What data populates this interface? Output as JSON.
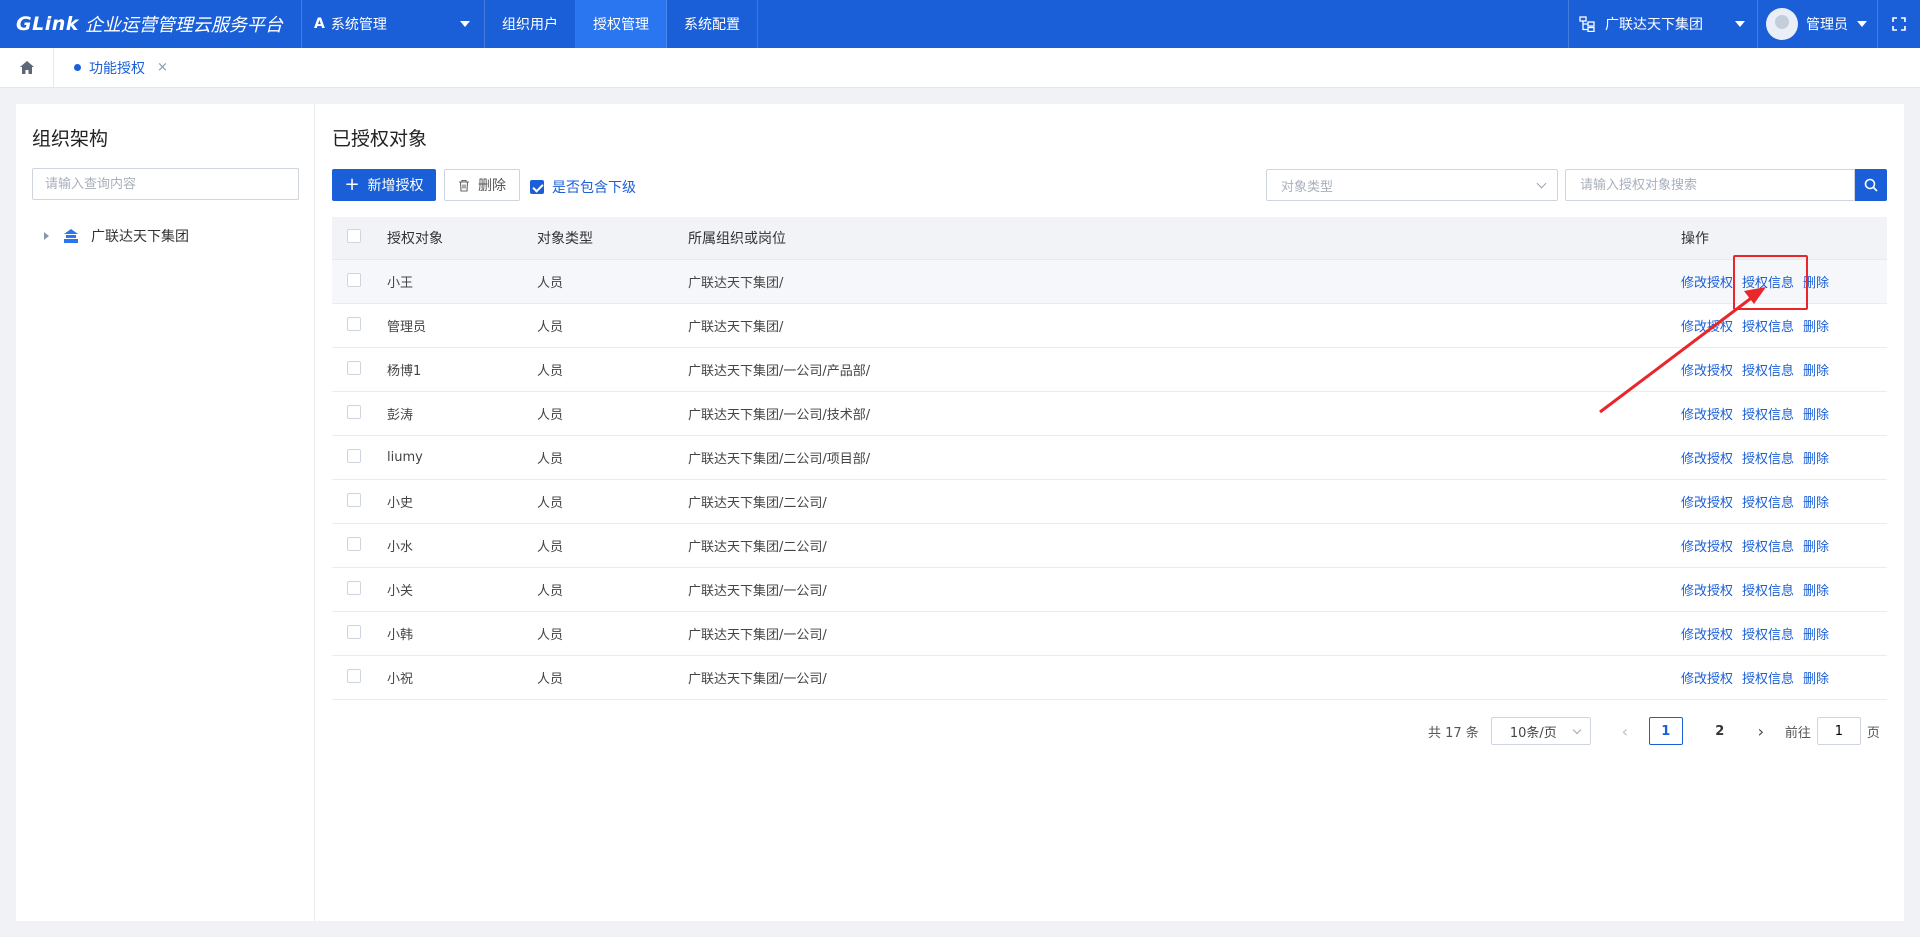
{
  "header": {
    "logo": "GLink",
    "platform_name": "企业运营管理云服务平台",
    "system_menu": "系统管理",
    "nav_tabs": [
      {
        "label": "组织用户"
      },
      {
        "label": "授权管理"
      },
      {
        "label": "系统配置"
      }
    ],
    "active_tab": "授权管理",
    "org_name": "广联达天下集团",
    "user_name": "管理员",
    "brand_color": "#1a5fd8"
  },
  "breadcrumb": {
    "tab_label": "功能授权",
    "close_label": "×"
  },
  "left_panel": {
    "title": "组织架构",
    "search_placeholder": "请输入查询内容",
    "tree": [
      {
        "label": "广联达天下集团"
      }
    ]
  },
  "main": {
    "title": "已授权对象",
    "add_button": "新增授权",
    "delete_button": "删除",
    "include_sub_label": "是否包含下级",
    "include_sub_checked": true,
    "type_select_placeholder": "对象类型",
    "search_placeholder": "请输入授权对象搜索",
    "table": {
      "headers": {
        "object": "授权对象",
        "type": "对象类型",
        "org": "所属组织或岗位",
        "ops": "操作"
      },
      "action_labels": {
        "modify": "修改授权",
        "info": "授权信息",
        "delete": "删除"
      },
      "rows": [
        {
          "object": "小王",
          "type": "人员",
          "org": "广联达天下集团/"
        },
        {
          "object": "管理员",
          "type": "人员",
          "org": "广联达天下集团/"
        },
        {
          "object": "杨博1",
          "type": "人员",
          "org": "广联达天下集团/一公司/产品部/"
        },
        {
          "object": "彭涛",
          "type": "人员",
          "org": "广联达天下集团/一公司/技术部/"
        },
        {
          "object": "liumy",
          "type": "人员",
          "org": "广联达天下集团/二公司/项目部/"
        },
        {
          "object": "小史",
          "type": "人员",
          "org": "广联达天下集团/二公司/"
        },
        {
          "object": "小水",
          "type": "人员",
          "org": "广联达天下集团/二公司/"
        },
        {
          "object": "小关",
          "type": "人员",
          "org": "广联达天下集团/一公司/"
        },
        {
          "object": "小韩",
          "type": "人员",
          "org": "广联达天下集团/一公司/"
        },
        {
          "object": "小祝",
          "type": "人员",
          "org": "广联达天下集团/一公司/"
        }
      ]
    },
    "pagination": {
      "total": "共 17 条",
      "page_size": "10条/页",
      "pages": [
        "1",
        "2"
      ],
      "current_page": "1",
      "goto_label": "前往",
      "goto_value": "1",
      "page_suffix": "页"
    }
  },
  "annotation": {
    "color": "#e8262b"
  }
}
